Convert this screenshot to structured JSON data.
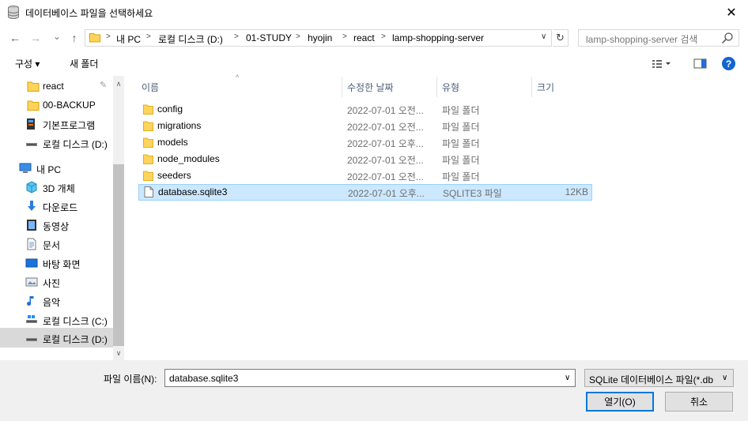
{
  "window": {
    "title": "데이터베이스 파일을 선택하세요",
    "close": "✕"
  },
  "nav": {
    "back": "←",
    "forward": "→",
    "recent": "⌄",
    "up": "↑",
    "breadcrumb": [
      "내 PC",
      "로컬 디스크 (D:)",
      "01-STUDY",
      "hyojin",
      "react",
      "lamp-shopping-server"
    ],
    "refresh": "↻",
    "search_placeholder": "lamp-shopping-server 검색"
  },
  "toolbar": {
    "organize": "구성 ▾",
    "new_folder": "새 폴더"
  },
  "sidebar": {
    "items": [
      {
        "label": "react",
        "icon": "folder-icon",
        "pinned": true
      },
      {
        "label": "00-BACKUP",
        "icon": "folder-icon"
      },
      {
        "label": "기본프로그램",
        "icon": "program-icon"
      },
      {
        "label": "로컬 디스크 (D:)",
        "icon": "drive-icon"
      },
      {
        "label": "내 PC",
        "icon": "pc-icon"
      },
      {
        "label": "3D 개체",
        "icon": "3d-objects-icon"
      },
      {
        "label": "다운로드",
        "icon": "download-icon"
      },
      {
        "label": "동영상",
        "icon": "video-icon"
      },
      {
        "label": "문서",
        "icon": "document-icon"
      },
      {
        "label": "바탕 화면",
        "icon": "desktop-icon"
      },
      {
        "label": "사진",
        "icon": "pictures-icon"
      },
      {
        "label": "음악",
        "icon": "music-icon"
      },
      {
        "label": "로컬 디스크 (C:)",
        "icon": "drive-icon"
      },
      {
        "label": "로컬 디스크 (D:)",
        "icon": "drive-icon"
      }
    ]
  },
  "columns": {
    "name": "이름",
    "date": "수정한 날짜",
    "type": "유형",
    "size": "크기"
  },
  "files": [
    {
      "name": "config",
      "date": "2022-07-01 오전...",
      "type": "파일 폴더",
      "size": "",
      "icon": "folder-icon"
    },
    {
      "name": "migrations",
      "date": "2022-07-01 오전...",
      "type": "파일 폴더",
      "size": "",
      "icon": "folder-icon"
    },
    {
      "name": "models",
      "date": "2022-07-01 오후...",
      "type": "파일 폴더",
      "size": "",
      "icon": "folder-icon"
    },
    {
      "name": "node_modules",
      "date": "2022-07-01 오전...",
      "type": "파일 폴더",
      "size": "",
      "icon": "folder-icon"
    },
    {
      "name": "seeders",
      "date": "2022-07-01 오전...",
      "type": "파일 폴더",
      "size": "",
      "icon": "folder-icon"
    },
    {
      "name": "database.sqlite3",
      "date": "2022-07-01 오후...",
      "type": "SQLITE3 파일",
      "size": "12KB",
      "icon": "file-icon",
      "selected": true
    }
  ],
  "footer": {
    "filename_label": "파일 이름(N):",
    "filename_value": "database.sqlite3",
    "filetype_value": "SQLite 데이터베이스 파일(*.db",
    "open": "열기(O)",
    "cancel": "취소"
  },
  "colors": {
    "accent": "#0078d7",
    "selection": "#cce8ff",
    "folder": "#ffd45c"
  }
}
